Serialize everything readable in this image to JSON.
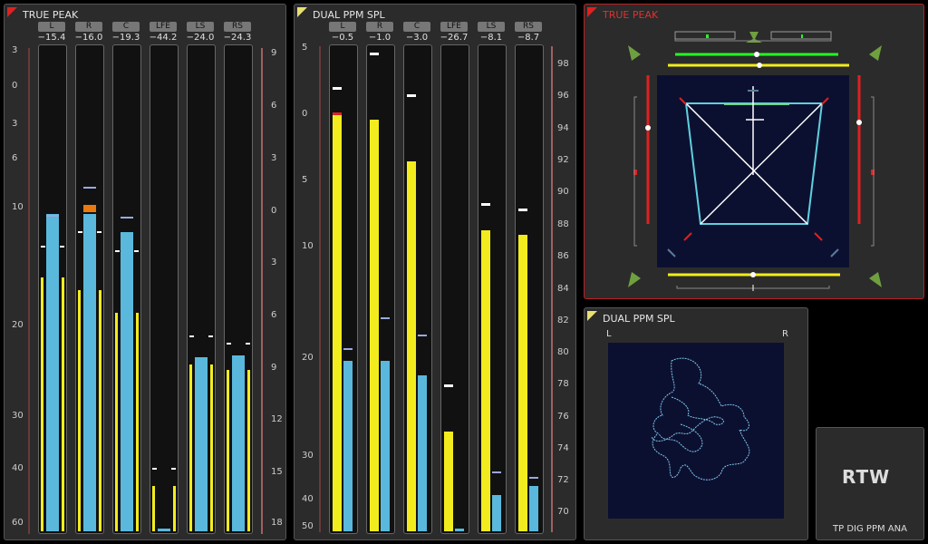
{
  "panel1": {
    "title": "TRUE PEAK",
    "channels": [
      "L",
      "R",
      "C",
      "LFE",
      "LS",
      "RS"
    ],
    "peaks": [
      "−15.4",
      "−16.0",
      "−19.3",
      "−44.2",
      "−24.0",
      "−24.3"
    ],
    "scale_left": [
      "3",
      "0",
      "3",
      "6",
      "10",
      "20",
      "30",
      "40",
      "60"
    ],
    "scale_right": [
      "9",
      "6",
      "3",
      "0",
      "3",
      "6",
      "9",
      "12",
      "15",
      "18"
    ]
  },
  "panel2": {
    "title": "DUAL PPM SPL",
    "channels": [
      "L",
      "R",
      "C",
      "LFE",
      "LS",
      "RS"
    ],
    "peaks": [
      "−0.5",
      "−1.0",
      "−3.0",
      "−26.7",
      "−8.1",
      "−8.7"
    ],
    "scale_left": [
      "5",
      "0",
      "5",
      "10",
      "20",
      "30",
      "40",
      "50"
    ],
    "scale_right": [
      "98",
      "96",
      "94",
      "92",
      "90",
      "88",
      "86",
      "84",
      "82",
      "80",
      "78",
      "76",
      "74",
      "72",
      "70"
    ]
  },
  "panel3": {
    "title": "TRUE PEAK"
  },
  "panel4": {
    "title": "DUAL PPM SPL",
    "left_label": "L",
    "right_label": "R"
  },
  "logo": {
    "brand": "RTW",
    "caption": "TP DIG PPM ANA"
  },
  "colors": {
    "yellow": "#f2ec1e",
    "blue": "#5ab8dc",
    "orange": "#e87a10",
    "red": "#e02020",
    "green": "#6fa040"
  }
}
